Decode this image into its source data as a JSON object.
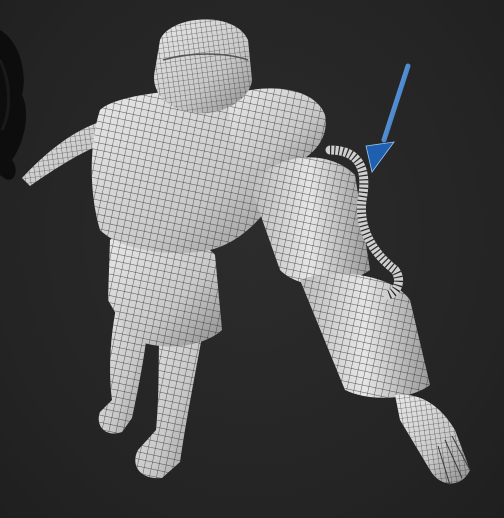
{
  "viewport": {
    "background": "#262626",
    "mesh_fill": "#d9d9d9",
    "mesh_shadow": "#8f8f8f",
    "wire_color": "#2a2a2a",
    "accent_arrow": "#2f7fd6"
  },
  "scene": {
    "subject": "wireframe-armored-character",
    "annotation": "arrow-icon"
  }
}
